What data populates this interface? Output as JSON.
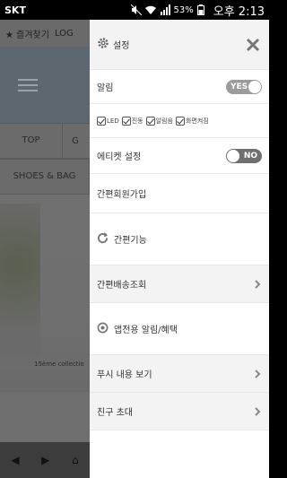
{
  "status_bar": {
    "carrier": "SKT",
    "battery": "53%",
    "time": "오후 2:13"
  },
  "background_app": {
    "top_text": "★ 즐겨찾기",
    "top_text2": "LOG",
    "category_1": "TOP",
    "category_2": "G",
    "category_3": "SHOES & BAG",
    "caption": "15ème collectio"
  },
  "drawer": {
    "header_title": "설정",
    "notifications_label": "알림",
    "notifications_toggle": "YES",
    "checks": [
      {
        "label": "LED"
      },
      {
        "label": "진동"
      },
      {
        "label": "알림음"
      },
      {
        "label": "화면켜짐"
      }
    ],
    "etiquette_label": "에티켓 설정",
    "etiquette_toggle": "NO",
    "simple_signup": "간편회원가입",
    "simple_function": "간편기능",
    "simple_delivery": "간편배송조회",
    "app_notice": "앱전용 알림/혜택",
    "push_view": "푸시 내용 보기",
    "invite": "친구 초대"
  },
  "colors": {
    "drawer_gray": "#f3f3f3",
    "toggle_on": "#9b9b9b",
    "toggle_off": "#6f6f6f"
  }
}
